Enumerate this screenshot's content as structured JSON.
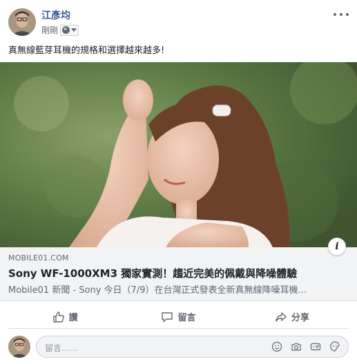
{
  "post": {
    "author": "江彥均",
    "timestamp": "剛剛",
    "privacy_icon": "globe-icon",
    "message": "真無線藍芽耳機的規格和選擇越來越多!"
  },
  "link": {
    "domain": "MOBILE01.COM",
    "title": "Sony WF-1000XM3 獨家實測！趨近完美的佩戴與降噪體驗",
    "description": "Mobile01 新聞 - Sony 今日（7/9）在台灣正式發表全新真無線降噪耳機...",
    "info_label": "i"
  },
  "actions": {
    "like": "讚",
    "comment": "留言",
    "share": "分享"
  },
  "comment_input": {
    "placeholder": "留言……"
  },
  "icons": {
    "more": "more-options-icon",
    "like": "thumbs-up-icon",
    "comment": "comment-bubble-icon",
    "share": "share-arrow-icon",
    "emoji": "emoji-icon",
    "camera": "camera-icon",
    "gif": "gif-icon",
    "sticker": "sticker-icon"
  },
  "colors": {
    "author_link": "#385898",
    "secondary_text": "#606770",
    "link_body_bg": "#f2f3f5"
  }
}
